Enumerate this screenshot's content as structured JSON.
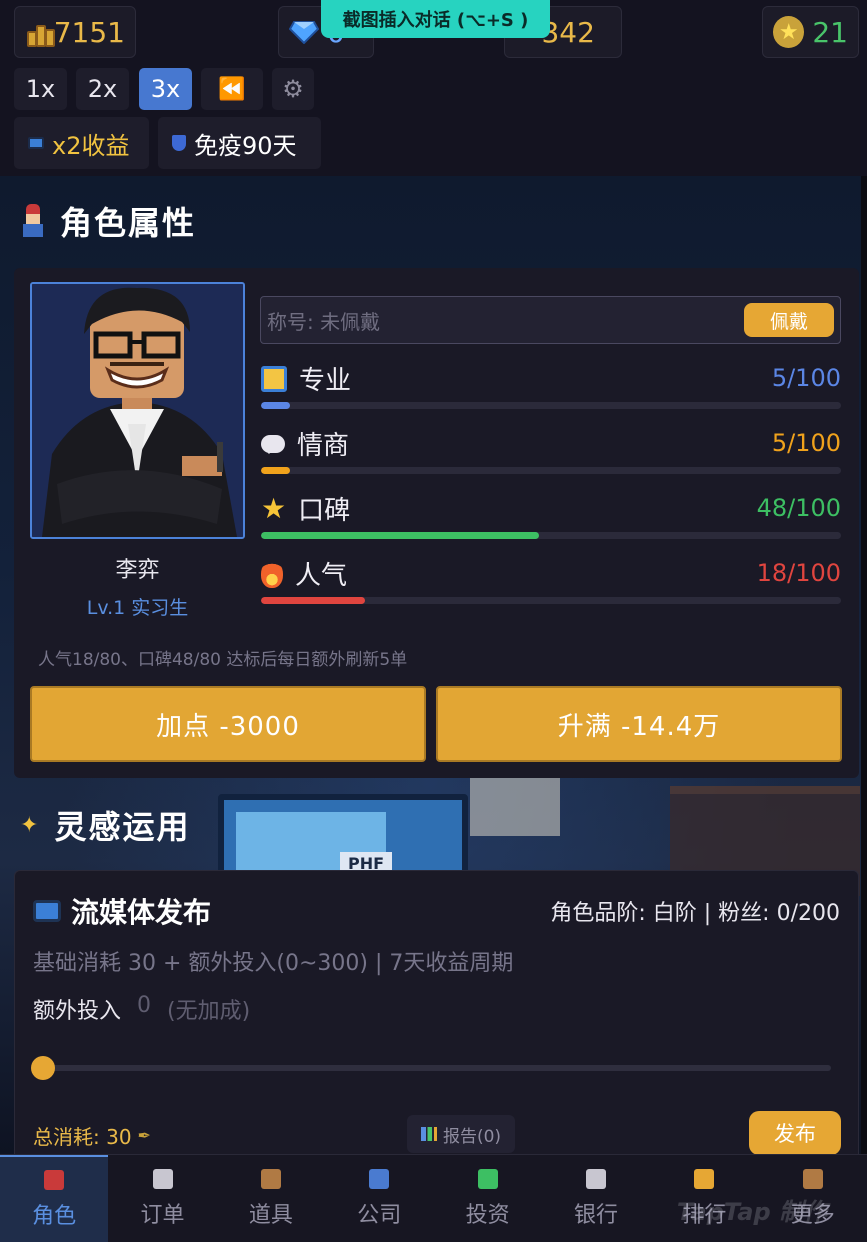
{
  "resources": {
    "coins": "7151",
    "gems": "0",
    "ink": "342",
    "stars": "21"
  },
  "toast": "截图插入对话 (⌥+S )",
  "speed": {
    "x1": "1x",
    "x2": "2x",
    "x3": "3x",
    "rewind": "⏪",
    "settings": "⚙",
    "active": "3x"
  },
  "buffs": {
    "income": "x2收益",
    "immune": "免疫90天"
  },
  "attributes": {
    "section_title": "角色属性",
    "character": {
      "name": "李弈",
      "level": "Lv.1 实习生"
    },
    "title_slot": {
      "text": "称号: 未佩戴",
      "button": "佩戴"
    },
    "stats": [
      {
        "label": "专业",
        "value": "5/100",
        "progress": 0.05,
        "color": "#5b86e5",
        "icon": "ruler-icon"
      },
      {
        "label": "情商",
        "value": "5/100",
        "progress": 0.05,
        "color": "#f0a21c",
        "icon": "speech-bubble-icon"
      },
      {
        "label": "口碑",
        "value": "48/100",
        "progress": 0.48,
        "color": "#3dbf63",
        "icon": "star-icon"
      },
      {
        "label": "人气",
        "value": "18/100",
        "progress": 0.18,
        "color": "#e0453f",
        "icon": "fire-icon"
      }
    ],
    "hint": "人气18/80、口碑48/80 达标后每日额外刷新5单",
    "add_point_button": "加点 -3000",
    "max_button": "升满 -14.4万"
  },
  "inspiration": {
    "section_title": "灵感运用",
    "background_label": "PHF"
  },
  "stream": {
    "title": "流媒体发布",
    "grade": "角色品阶: 白阶 | 粉丝: 0/200",
    "description": "基础消耗 30 + 额外投入(0~300) | 7天收益周期",
    "extra_label": "额外投入",
    "extra_value": "0",
    "extra_note": "(无加成)",
    "slider_value": 0,
    "total": "总消耗: 30",
    "report": "报告(0)",
    "publish": "发布"
  },
  "nav": [
    {
      "label": "角色",
      "active": true,
      "color": "#c93a3a"
    },
    {
      "label": "订单",
      "active": false,
      "color": "#c8c6d0"
    },
    {
      "label": "道具",
      "active": false,
      "color": "#b07a44"
    },
    {
      "label": "公司",
      "active": false,
      "color": "#4a7bd0"
    },
    {
      "label": "投资",
      "active": false,
      "color": "#3dbf63"
    },
    {
      "label": "银行",
      "active": false,
      "color": "#c8c6d0"
    },
    {
      "label": "排行",
      "active": false,
      "color": "#e6a734"
    },
    {
      "label": "更多",
      "active": false,
      "color": "#b07a44"
    }
  ],
  "watermark": "TapTap 制作"
}
